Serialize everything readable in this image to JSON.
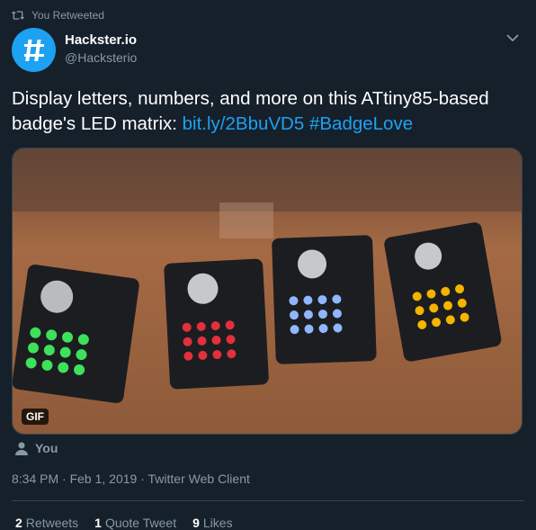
{
  "retweet_context": {
    "label": "You Retweeted",
    "icon": "retweet-icon"
  },
  "author": {
    "name": "Hackster.io",
    "handle": "@Hacksterio",
    "avatar_color": "#1da1f2",
    "avatar_icon": "hackster-logo"
  },
  "tweet": {
    "text_plain": "Display letters, numbers, and more on this ATtiny85-based badge's LED matrix:",
    "link": "bit.ly/2BbuVD5",
    "hashtag": "#BadgeLove"
  },
  "media": {
    "badge": "GIF",
    "description_colors": [
      "green",
      "red",
      "blue",
      "yellow"
    ]
  },
  "liked_by": {
    "label": "You",
    "icon": "person-icon"
  },
  "meta": {
    "time": "8:34 PM",
    "date": "Feb 1, 2019",
    "source": "Twitter Web Client",
    "separator": " · "
  },
  "stats": {
    "retweets": {
      "count": "2",
      "label": "Retweets"
    },
    "quotes": {
      "count": "1",
      "label": "Quote Tweet"
    },
    "likes": {
      "count": "9",
      "label": "Likes"
    }
  },
  "colors": {
    "background": "#15202b",
    "link": "#1da1f2",
    "secondary_text": "#8899a6",
    "border": "#38444d"
  }
}
